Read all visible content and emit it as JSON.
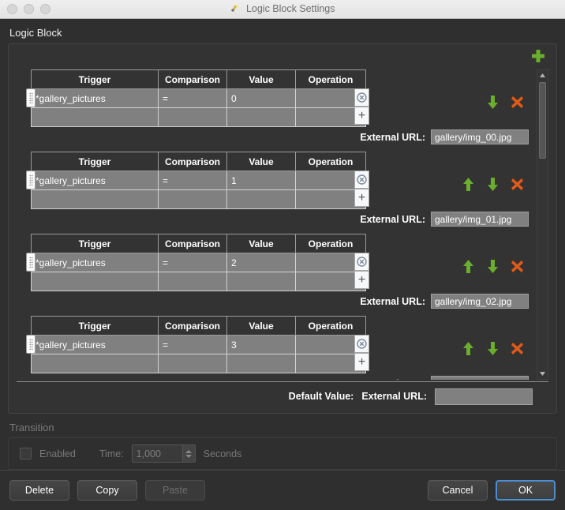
{
  "window": {
    "title": "Logic Block Settings",
    "title_icon": "app-icon",
    "traffic_lights": [
      "close",
      "minimize",
      "maximize"
    ]
  },
  "main": {
    "section_title": "Logic Block",
    "add_button_label": "+",
    "add_button_icon": "plus-icon",
    "columns": [
      "Trigger",
      "Comparison",
      "Value",
      "Operation"
    ],
    "row_delete_icon": "circle-x-icon",
    "row_add_icon": "plus-icon",
    "entries": [
      {
        "trigger": "*gallery_pictures",
        "comparison": "=",
        "value": "0",
        "operation": "",
        "external_url_label": "External URL:",
        "external_url": "gallery/img_00.jpg",
        "actions": [
          "move-down",
          "delete"
        ]
      },
      {
        "trigger": "*gallery_pictures",
        "comparison": "=",
        "value": "1",
        "operation": "",
        "external_url_label": "External URL:",
        "external_url": "gallery/img_01.jpg",
        "actions": [
          "move-up",
          "move-down",
          "delete"
        ]
      },
      {
        "trigger": "*gallery_pictures",
        "comparison": "=",
        "value": "2",
        "operation": "",
        "external_url_label": "External URL:",
        "external_url": "gallery/img_02.jpg",
        "actions": [
          "move-up",
          "move-down",
          "delete"
        ]
      },
      {
        "trigger": "*gallery_pictures",
        "comparison": "=",
        "value": "3",
        "operation": "",
        "external_url_label": "External URL:",
        "external_url": "",
        "actions": [
          "move-up",
          "move-down",
          "delete"
        ]
      }
    ],
    "default_value_label": "Default Value:",
    "default_external_url_label": "External URL:",
    "default_external_url": ""
  },
  "transition": {
    "title": "Transition",
    "enabled_label": "Enabled",
    "enabled_checked": false,
    "time_label": "Time:",
    "time_value": "1,000",
    "seconds_label": "Seconds",
    "disabled": true
  },
  "footer": {
    "delete_label": "Delete",
    "copy_label": "Copy",
    "paste_label": "Paste",
    "paste_disabled": true,
    "cancel_label": "Cancel",
    "ok_label": "OK"
  },
  "colors": {
    "accent_green": "#6aad2f",
    "accent_orange": "#e05a19",
    "focus_blue": "#4a8fd4",
    "cell_grey": "#808080",
    "window_bg": "#2f2f2f"
  }
}
